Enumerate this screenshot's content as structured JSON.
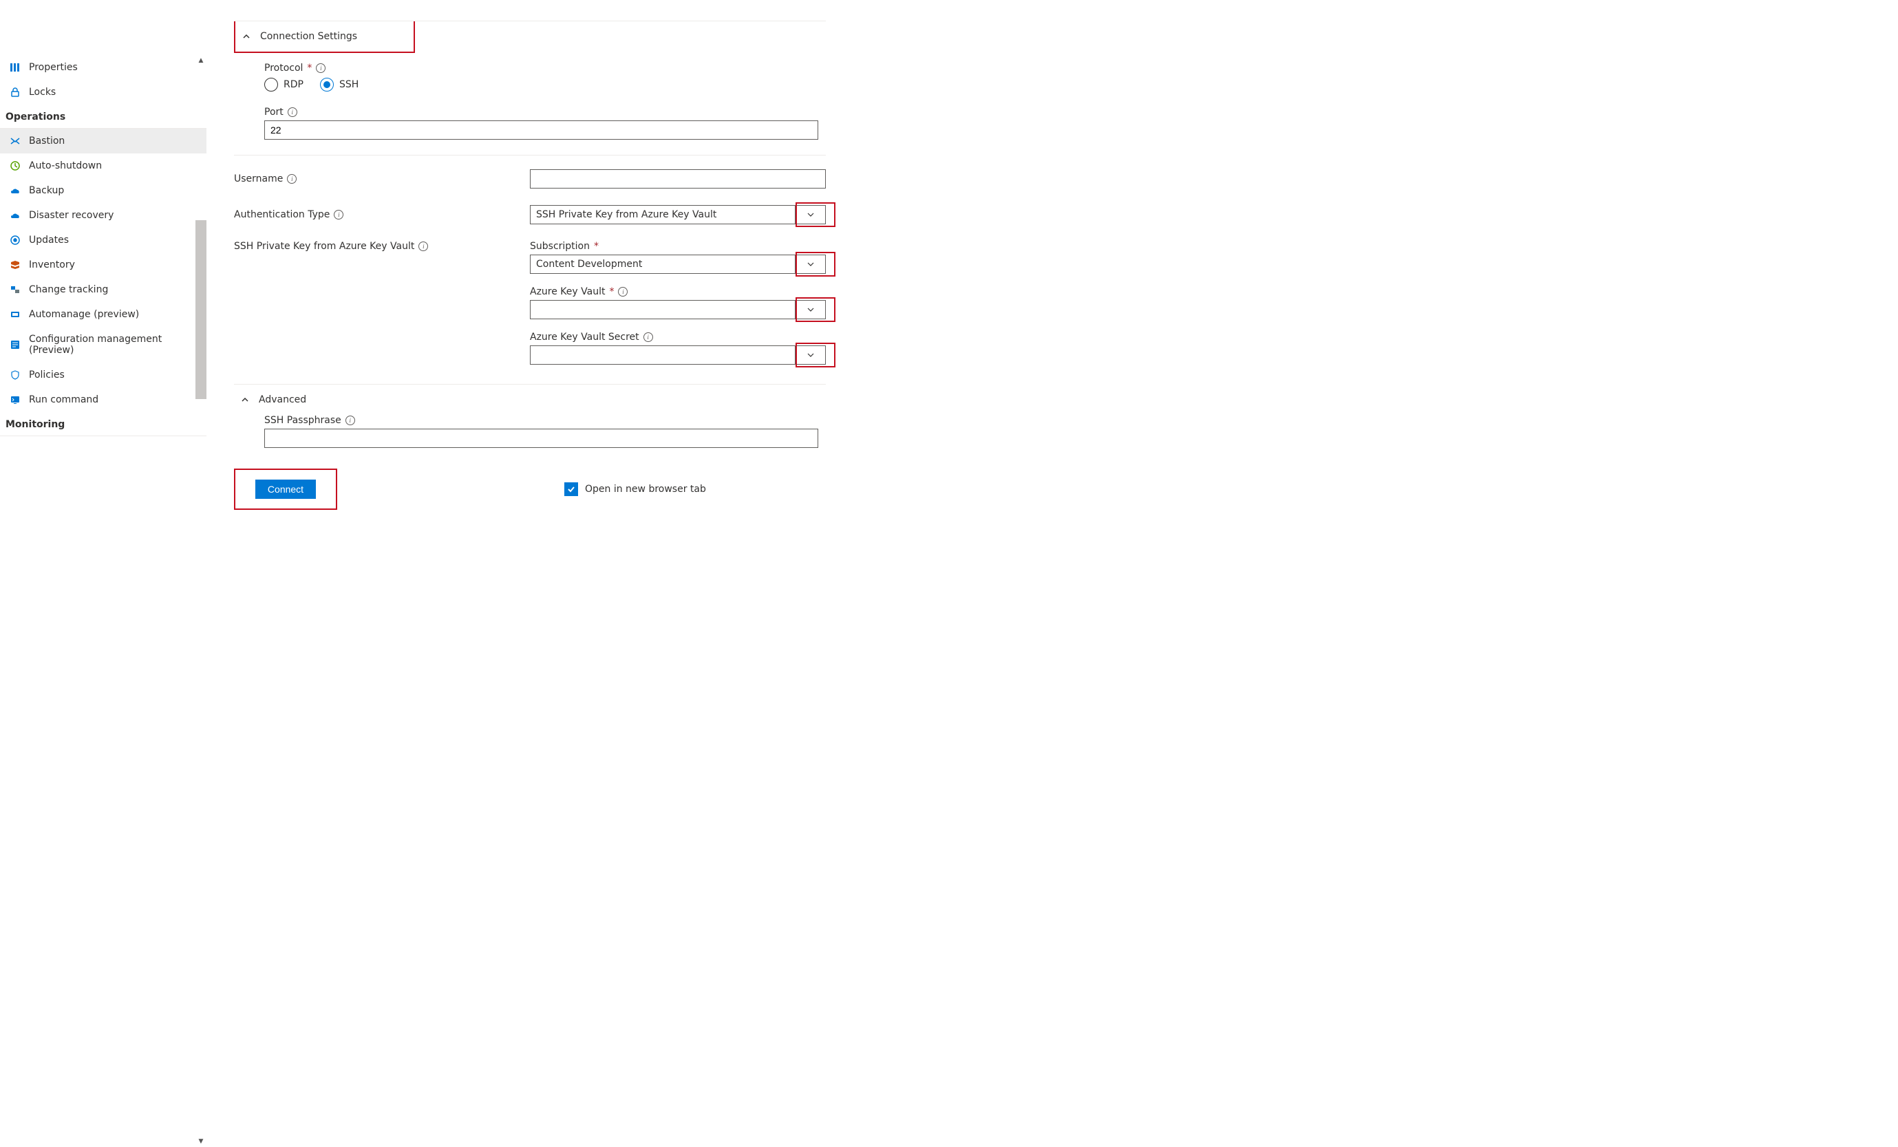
{
  "sidebar": {
    "items_top": [
      {
        "label": "Properties",
        "icon": "properties-icon"
      },
      {
        "label": "Locks",
        "icon": "locks-icon"
      }
    ],
    "section_operations": "Operations",
    "items_operations": [
      {
        "label": "Bastion",
        "icon": "bastion-icon",
        "selected": true
      },
      {
        "label": "Auto-shutdown",
        "icon": "auto-shutdown-icon"
      },
      {
        "label": "Backup",
        "icon": "backup-icon"
      },
      {
        "label": "Disaster recovery",
        "icon": "disaster-recovery-icon"
      },
      {
        "label": "Updates",
        "icon": "updates-icon"
      },
      {
        "label": "Inventory",
        "icon": "inventory-icon"
      },
      {
        "label": "Change tracking",
        "icon": "change-tracking-icon"
      },
      {
        "label": "Automanage (preview)",
        "icon": "automanage-icon"
      },
      {
        "label": "Configuration management (Preview)",
        "icon": "configuration-management-icon"
      },
      {
        "label": "Policies",
        "icon": "policies-icon"
      },
      {
        "label": "Run command",
        "icon": "run-command-icon"
      }
    ],
    "section_monitoring": "Monitoring"
  },
  "main": {
    "connection_settings_header": "Connection Settings",
    "protocol": {
      "label": "Protocol",
      "options": {
        "rdp": "RDP",
        "ssh": "SSH"
      },
      "value": "ssh"
    },
    "port": {
      "label": "Port",
      "value": "22"
    },
    "username": {
      "label": "Username",
      "value": ""
    },
    "auth_type": {
      "label": "Authentication Type",
      "value": "SSH Private Key from Azure Key Vault"
    },
    "ssh_keyvault_label": "SSH Private Key from Azure Key Vault",
    "subscription": {
      "label": "Subscription",
      "value": "Content Development"
    },
    "azure_key_vault": {
      "label": "Azure Key Vault",
      "value": ""
    },
    "azure_key_vault_secret": {
      "label": "Azure Key Vault Secret",
      "value": ""
    },
    "advanced_header": "Advanced",
    "ssh_passphrase": {
      "label": "SSH Passphrase",
      "value": ""
    },
    "connect_button": "Connect",
    "open_new_tab": {
      "label": "Open in new browser tab",
      "checked": true
    }
  }
}
